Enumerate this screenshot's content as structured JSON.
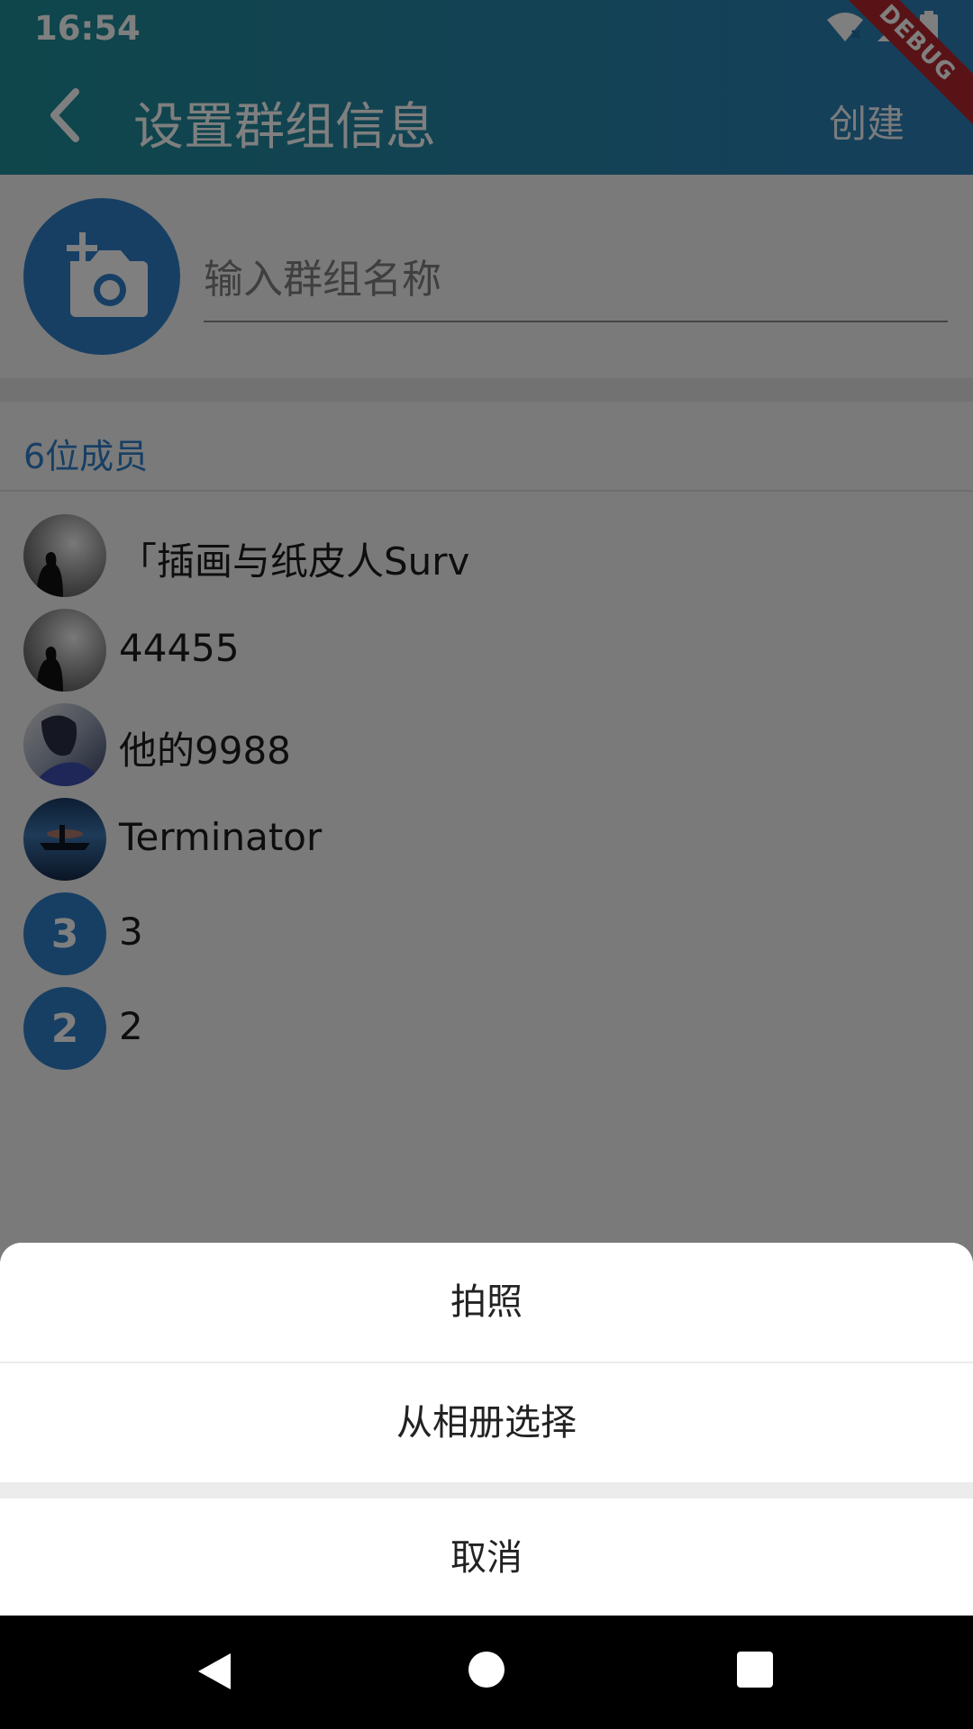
{
  "status_bar": {
    "time": "16:54",
    "icons": [
      "wifi-off-icon",
      "signal-icon",
      "battery-icon"
    ]
  },
  "app_bar": {
    "title": "设置群组信息",
    "back_icon": "back-arrow-icon",
    "action_label": "创建",
    "debug_banner": "DEBUG"
  },
  "group_info": {
    "avatar_icon": "add-photo-icon",
    "name_placeholder": "输入群组名称",
    "name_value": ""
  },
  "members": {
    "count_label": "6位成员",
    "items": [
      {
        "name": "「插画与纸皮人Surv",
        "avatar_type": "image"
      },
      {
        "name": "44455",
        "avatar_type": "image"
      },
      {
        "name": "他的9988",
        "avatar_type": "image"
      },
      {
        "name": "Terminator",
        "avatar_type": "image"
      },
      {
        "name": "3",
        "avatar_letter": "3",
        "avatar_type": "letter"
      },
      {
        "name": "2",
        "avatar_letter": "2",
        "avatar_type": "letter"
      }
    ]
  },
  "action_sheet": {
    "options": [
      "拍照",
      "从相册选择"
    ],
    "cancel_label": "取消"
  },
  "nav_bar": {
    "icons": [
      "nav-back-icon",
      "nav-home-icon",
      "nav-recents-icon"
    ]
  },
  "colors": {
    "accent": "#2e7fc8",
    "appbar_start": "#1e8c96",
    "appbar_end": "#2c7eb8",
    "debug": "#b3262c"
  }
}
